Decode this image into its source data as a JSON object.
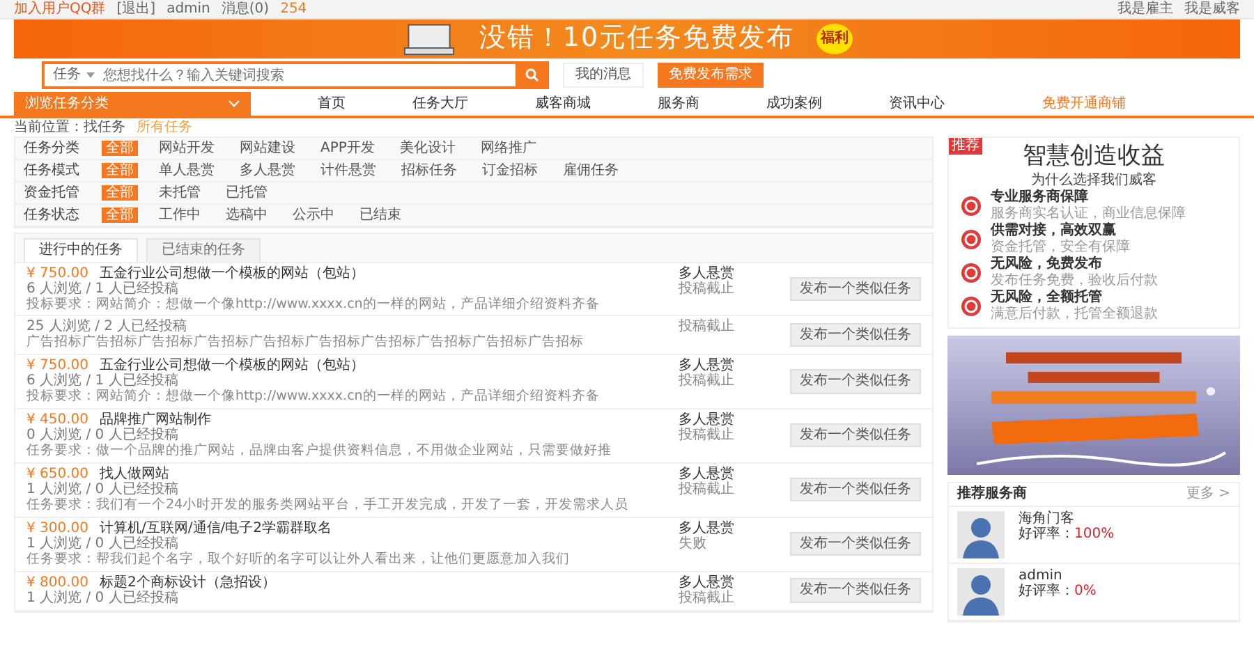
{
  "top_bar": {
    "left_links": [
      "加入用户QQ群",
      "[退出]",
      "admin",
      "消息(0)",
      "254"
    ],
    "right_links": [
      "我是雇主",
      "我是威客"
    ]
  },
  "banner": {
    "headline": "没错！10元任务免费发布",
    "badge": "福利"
  },
  "search": {
    "scope": "任务",
    "placeholder": "您想找什么？输入关键词搜索",
    "messages": "我的消息",
    "publish": "免费发布需求"
  },
  "nav": {
    "category_menu": "浏览任务分类",
    "items": [
      "首页",
      "任务大厅",
      "威客商城",
      "服务商",
      "成功案例",
      "资讯中心"
    ],
    "shop_link": "免费开通商铺"
  },
  "breadcrumb": {
    "prefix": "当前位置：找任务",
    "current": "所有任务"
  },
  "filters": [
    {
      "label": "任务分类",
      "options": [
        {
          "label": "全部",
          "selected": true
        },
        {
          "label": "网站开发",
          "selected": false
        },
        {
          "label": "网站建设",
          "selected": false
        },
        {
          "label": "APP开发",
          "selected": false
        },
        {
          "label": "美化设计",
          "selected": false
        },
        {
          "label": "网络推广",
          "selected": false
        }
      ]
    },
    {
      "label": "任务模式",
      "options": [
        {
          "label": "全部",
          "selected": true
        },
        {
          "label": "单人悬赏",
          "selected": false
        },
        {
          "label": "多人悬赏",
          "selected": false
        },
        {
          "label": "计件悬赏",
          "selected": false
        },
        {
          "label": "招标任务",
          "selected": false
        },
        {
          "label": "订金招标",
          "selected": false
        },
        {
          "label": "雇佣任务",
          "selected": false
        }
      ]
    },
    {
      "label": "资金托管",
      "options": [
        {
          "label": "全部",
          "selected": true
        },
        {
          "label": "未托管",
          "selected": false
        },
        {
          "label": "已托管",
          "selected": false
        }
      ]
    },
    {
      "label": "任务状态",
      "options": [
        {
          "label": "全部",
          "selected": true
        },
        {
          "label": "工作中",
          "selected": false
        },
        {
          "label": "选稿中",
          "selected": false
        },
        {
          "label": "公示中",
          "selected": false
        },
        {
          "label": "已结束",
          "selected": false
        }
      ]
    }
  ],
  "tabs": [
    {
      "label": "进行中的任务",
      "selected": true
    },
    {
      "label": "已结束的任务",
      "selected": false
    }
  ],
  "tasks": [
    {
      "price": "¥ 750.00",
      "title": "五金行业公司想做一个模板的网站（包站）",
      "stats": "6 人浏览 / 1 人已经投稿",
      "description": "投标要求：网站简介：想做一个像http://www.xxxx.cn的一样的网站，产品详细介绍资料齐备",
      "mode": "多人悬赏",
      "status": "投稿截止",
      "action": "发布一个类似任务"
    },
    {
      "stats": "25 人浏览 / 2 人已经投稿",
      "description": "广告招标广告招标广告招标广告招标广告招标广告招标广告招标广告招标广告招标广告招标",
      "status": "投稿截止",
      "action": "发布一个类似任务"
    },
    {
      "price": "¥ 750.00",
      "title": "五金行业公司想做一个模板的网站（包站）",
      "stats": "6 人浏览 / 1 人已经投稿",
      "description": "投标要求：网站简介：想做一个像http://www.xxxx.cn的一样的网站，产品详细介绍资料齐备",
      "mode": "多人悬赏",
      "status": "投稿截止",
      "action": "发布一个类似任务"
    },
    {
      "price": "¥ 450.00",
      "title": "品牌推广网站制作",
      "stats": "0 人浏览 / 0 人已经投稿",
      "description": "任务要求：做一个品牌的推广网站，品牌由客户提供资料信息，不用做企业网站，只需要做好推",
      "mode": "多人悬赏",
      "status": "投稿截止",
      "action": "发布一个类似任务"
    },
    {
      "price": "¥ 650.00",
      "title": "找人做网站",
      "stats": "1 人浏览 / 0 人已经投稿",
      "description": "任务要求：我们有一个24小时开发的服务类网站平台，手工开发完成，开发了一套，开发需求人员",
      "mode": "多人悬赏",
      "status": "投稿截止",
      "action": "发布一个类似任务"
    },
    {
      "price": "¥ 300.00",
      "title": "计算机/互联网/通信/电子2学霸群取名",
      "stats": "1 人浏览 / 0 人已经投稿",
      "description": "任务要求：帮我们起个名字，取个好听的名字可以让外人看出来，让他们更愿意加入我们",
      "mode": "多人悬赏",
      "status": "失败",
      "action": "发布一个类似任务"
    },
    {
      "price": "¥ 800.00",
      "title": "标题2个商标设计（急招设）",
      "stats": "1 人浏览 / 0 人已经投稿",
      "mode": "多人悬赏",
      "status": "投稿截止",
      "action": "发布一个类似任务"
    }
  ],
  "promo": {
    "corner": "推荐",
    "title": "智慧创造收益",
    "subtitle": "为什么选择我们威客",
    "features": [
      {
        "title": "专业服务商保障",
        "text": "服务商实名认证，商业信息保障"
      },
      {
        "title": "供需对接，高效双赢",
        "text": "资金托管，安全有保障"
      },
      {
        "title": "无风险，免费发布",
        "text": "发布任务免费，验收后付款"
      },
      {
        "title": "无风险，全额托管",
        "text": "满意后付款，托管全额退款"
      }
    ]
  },
  "recommend": {
    "title": "推荐服务商",
    "more": "更多 >",
    "providers": [
      {
        "name": "海角门客",
        "rating_label": "好评率：",
        "rating": "100%"
      },
      {
        "name": "admin",
        "rating_label": "好评率：",
        "rating": "0%"
      }
    ]
  }
}
